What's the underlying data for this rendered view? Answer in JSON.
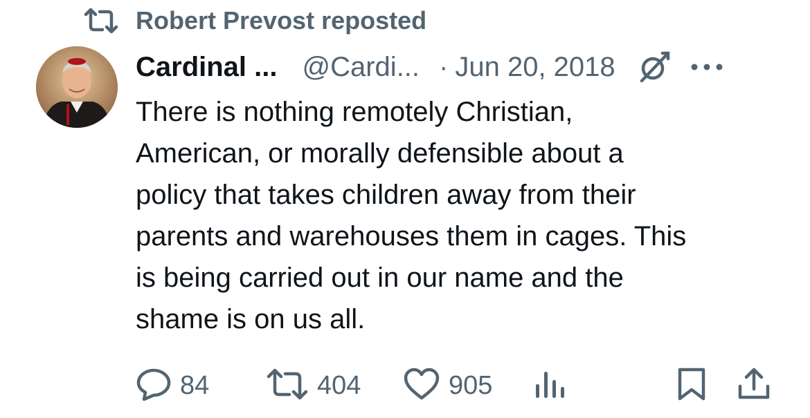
{
  "repost_banner": {
    "icon": "repost-icon",
    "text": "Robert Prevost reposted"
  },
  "tweet": {
    "author_name": "Cardinal ...",
    "author_handle": "@Cardi...",
    "separator": "·",
    "date": "Jun 20, 2018",
    "avatar_icon": "avatar-photo",
    "grok_icon": "grok-icon",
    "more_icon": "more-icon",
    "text": "There is nothing remotely Christian,\nAmerican, or morally defensible about a\npolicy that takes children away from their\nparents and warehouses them in cages. This\nis being carried out in our name and the\nshame is on us all."
  },
  "actions": {
    "replies": "84",
    "reposts": "404",
    "likes": "905"
  },
  "colors": {
    "text_primary": "#0f1419",
    "text_secondary": "#536471",
    "background": "#ffffff"
  }
}
